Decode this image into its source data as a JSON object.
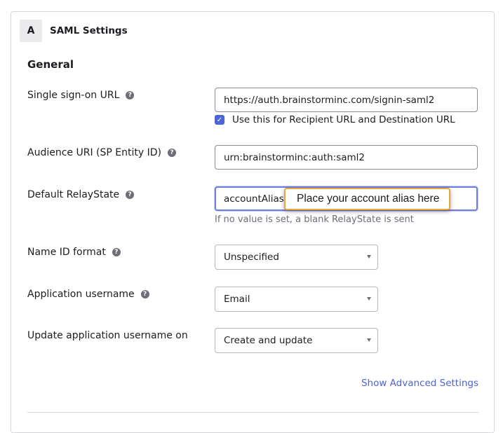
{
  "header": {
    "step_badge": "A",
    "title": "SAML Settings"
  },
  "section": {
    "title": "General"
  },
  "fields": {
    "sso_url": {
      "label": "Single sign-on URL",
      "value": "https://auth.brainstorminc.com/signin-saml2",
      "checkbox_label": "Use this for Recipient URL and Destination URL",
      "checkbox_checked": true
    },
    "audience_uri": {
      "label": "Audience URI (SP Entity ID)",
      "value": "urn:brainstorminc:auth:saml2"
    },
    "relay_state": {
      "label": "Default RelayState",
      "value": "accountAlias=",
      "hint": "If no value is set, a blank RelayState is sent"
    },
    "name_id_format": {
      "label": "Name ID format",
      "value": "Unspecified"
    },
    "app_username": {
      "label": "Application username",
      "value": "Email"
    },
    "update_username_on": {
      "label": "Update application username on",
      "value": "Create and update"
    }
  },
  "advanced_link": "Show Advanced Settings",
  "callout": "Place your account alias here",
  "colors": {
    "accent": "#4c64d5",
    "callout_border": "#e8a73b",
    "focus_border": "#6f7fe0"
  },
  "icons": {
    "help": "question-circle-icon",
    "check": "checkmark-icon",
    "caret": "chevron-down-icon"
  }
}
